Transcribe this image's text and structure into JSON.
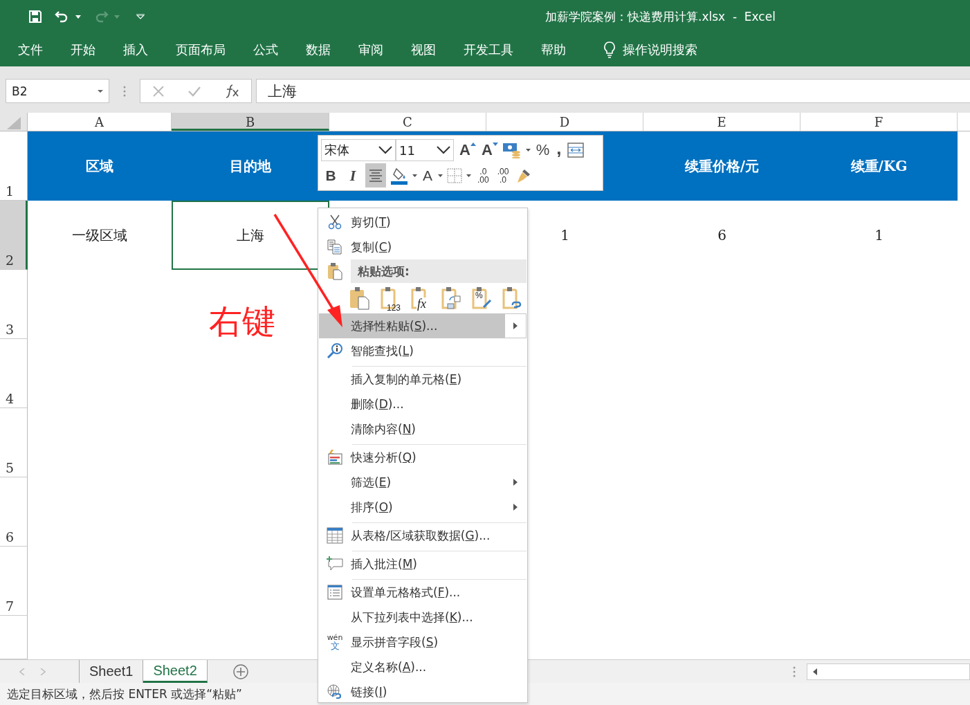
{
  "window": {
    "title": "加薪学院案例：快递费用计算.xlsx  -  Excel"
  },
  "ribbon_tabs": [
    "文件",
    "开始",
    "插入",
    "页面布局",
    "公式",
    "数据",
    "审阅",
    "视图",
    "开发工具",
    "帮助"
  ],
  "tell_me": "操作说明搜索",
  "name_box": "B2",
  "formula": "上海",
  "columns": [
    {
      "label": "A",
      "selected": false
    },
    {
      "label": "B",
      "selected": true
    },
    {
      "label": "C",
      "selected": false
    },
    {
      "label": "D",
      "selected": false
    },
    {
      "label": "E",
      "selected": false
    },
    {
      "label": "F",
      "selected": false
    }
  ],
  "rows": [
    {
      "header": "1",
      "kind": "header",
      "selected": false,
      "cells": [
        {
          "text": "区域",
          "selected": false
        },
        {
          "text": "目的地",
          "selected": false
        },
        null,
        null,
        {
          "text": "续重价格/元",
          "selected": false
        },
        {
          "text": "续重/KG",
          "selected": false
        }
      ]
    },
    {
      "header": "2",
      "kind": "data",
      "selected": true,
      "cells": [
        {
          "text": "一级区域",
          "selected": false
        },
        {
          "text": "上海",
          "selected": true
        },
        null,
        {
          "text": "1",
          "selected": false
        },
        {
          "text": "6",
          "selected": false
        },
        {
          "text": "1",
          "selected": false
        }
      ]
    },
    {
      "header": "3",
      "kind": "data",
      "selected": false,
      "cells": []
    },
    {
      "header": "4",
      "kind": "data",
      "selected": false,
      "cells": []
    },
    {
      "header": "5",
      "kind": "data",
      "selected": false,
      "cells": []
    },
    {
      "header": "6",
      "kind": "data",
      "selected": false,
      "cells": []
    },
    {
      "header": "7",
      "kind": "data",
      "selected": false,
      "cells": []
    }
  ],
  "mini_toolbar": {
    "font": "宋体",
    "size": "11",
    "row_1": [
      {
        "kind": "grow-font",
        "label": "A"
      },
      {
        "kind": "shrink-font",
        "label": "A"
      },
      {
        "kind": "accounting"
      },
      {
        "kind": "percent",
        "label": "%"
      },
      {
        "kind": "comma",
        "label": ","
      },
      {
        "kind": "wrap"
      }
    ],
    "row_2": [
      {
        "kind": "bold",
        "label": "B",
        "on": false
      },
      {
        "kind": "italic",
        "label": "I",
        "on": false
      },
      {
        "kind": "center",
        "on": true
      },
      {
        "kind": "fill-color"
      },
      {
        "kind": "font-color",
        "label": "A"
      },
      {
        "kind": "borders"
      },
      {
        "kind": "increase-decimal",
        "lines": [
          ".0",
          ".00"
        ]
      },
      {
        "kind": "decrease-decimal",
        "lines": [
          ".00",
          ".0"
        ]
      },
      {
        "kind": "format-painter"
      }
    ]
  },
  "context_menu": [
    {
      "kind": "cut",
      "label": "剪切(T)",
      "separator_above": false,
      "highlighted": false,
      "submenu": false
    },
    {
      "kind": "copy",
      "label": "复制(C)",
      "separator_above": false,
      "highlighted": false,
      "submenu": false
    },
    {
      "kind": "paste-header",
      "label": "粘贴选项:",
      "separator_above": false
    },
    {
      "kind": "paste-options",
      "options": [
        {
          "kind": "paste"
        },
        {
          "kind": "values",
          "label": "123"
        },
        {
          "kind": "formulas",
          "label": "fx"
        },
        {
          "kind": "transpose"
        },
        {
          "kind": "formatting",
          "label": "%"
        },
        {
          "kind": "link"
        }
      ],
      "separator_above": false
    },
    {
      "kind": "paste-special",
      "label": "选择性粘贴(S)...",
      "separator_above": false,
      "highlighted": true,
      "submenu": true
    },
    {
      "kind": "smart-lookup",
      "label": "智能查找(L)",
      "separator_above": false,
      "highlighted": false,
      "submenu": false
    },
    {
      "kind": "insert-copied",
      "label": "插入复制的单元格(E)",
      "separator_above": true,
      "highlighted": false,
      "submenu": false
    },
    {
      "kind": "delete",
      "label": "删除(D)...",
      "separator_above": false,
      "highlighted": false,
      "submenu": false
    },
    {
      "kind": "clear",
      "label": "清除内容(N)",
      "separator_above": false,
      "highlighted": false,
      "submenu": false
    },
    {
      "kind": "quick-analysis",
      "label": "快速分析(Q)",
      "separator_above": true,
      "highlighted": false,
      "submenu": false
    },
    {
      "kind": "filter",
      "label": "筛选(E)",
      "separator_above": false,
      "highlighted": false,
      "submenu": true
    },
    {
      "kind": "sort",
      "label": "排序(O)",
      "separator_above": false,
      "highlighted": false,
      "submenu": true
    },
    {
      "kind": "get-data",
      "label": "从表格/区域获取数据(G)...",
      "separator_above": true,
      "highlighted": false,
      "submenu": false
    },
    {
      "kind": "comment",
      "label": "插入批注(M)",
      "separator_above": true,
      "highlighted": false,
      "submenu": false
    },
    {
      "kind": "format-cells",
      "label": "设置单元格格式(F)...",
      "separator_above": true,
      "highlighted": false,
      "submenu": false
    },
    {
      "kind": "pick-list",
      "label": "从下拉列表中选择(K)...",
      "separator_above": false,
      "highlighted": false,
      "submenu": false
    },
    {
      "kind": "pinyin",
      "label": "显示拼音字段(S)",
      "icon_text": [
        "wén",
        "文"
      ],
      "separator_above": false,
      "highlighted": false,
      "submenu": false
    },
    {
      "kind": "define-name",
      "label": "定义名称(A)...",
      "separator_above": false,
      "highlighted": false,
      "submenu": false
    },
    {
      "kind": "link",
      "label": "链接(I)",
      "separator_above": false,
      "highlighted": false,
      "submenu": false
    }
  ],
  "annotation": {
    "text": "右键"
  },
  "sheet_tabs": [
    {
      "label": "Sheet1",
      "selected": false
    },
    {
      "label": "Sheet2",
      "selected": true
    }
  ],
  "status_bar": "选定目标区域，然后按 ENTER 或选择“粘贴”"
}
